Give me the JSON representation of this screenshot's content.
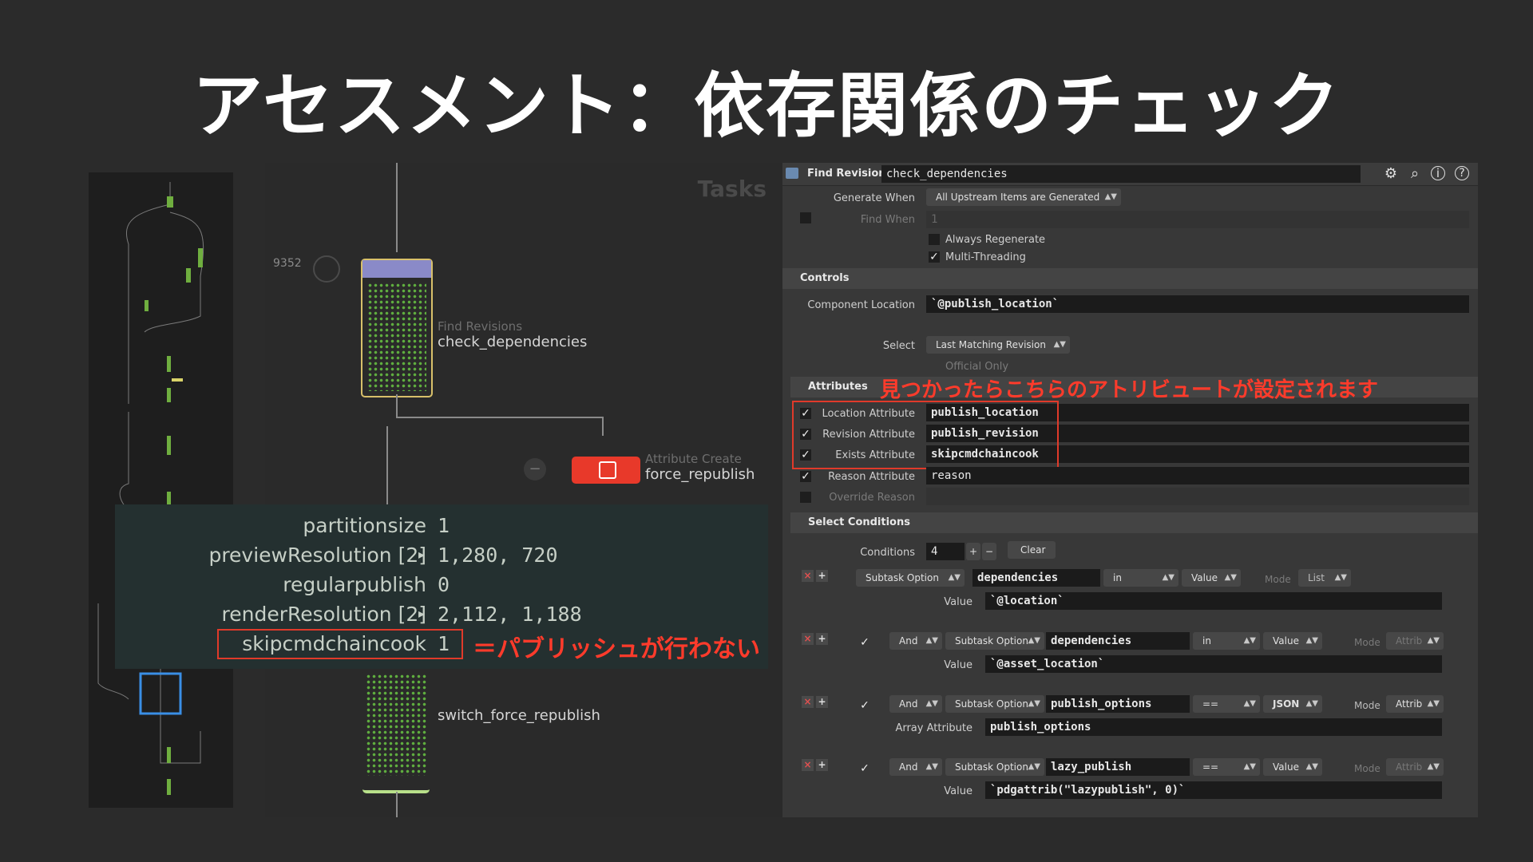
{
  "slide_title": "アセスメント：依存関係のチェック",
  "minimap": {},
  "network": {
    "tasks_label": "Tasks",
    "node_count": "9352",
    "find_node": {
      "type": "Find Revisions",
      "name": "check_dependencies"
    },
    "attr_node": {
      "type": "Attribute Create",
      "name": "force_republish"
    },
    "switch_node": {
      "name": "switch_force_republish"
    }
  },
  "overlay": {
    "rows": [
      {
        "key": "partitionsize",
        "value": "1",
        "arrow": ""
      },
      {
        "key": "previewResolution [2]",
        "value": "1,280,  720",
        "arrow": "▸"
      },
      {
        "key": "regularpublish",
        "value": "0",
        "arrow": ""
      },
      {
        "key": "renderResolution [2]",
        "value": "2,112,  1,188",
        "arrow": "▸"
      },
      {
        "key": "skipcmdchaincook",
        "value": "1",
        "arrow": ""
      }
    ],
    "note": "＝パブリッシュが行わない"
  },
  "panel": {
    "header_type": "Find Revisions",
    "header_name": "check_dependencies",
    "generate_when_label": "Generate When",
    "generate_when_value": "All Upstream Items are Generated",
    "find_when_label": "Find When",
    "find_when_value": "1",
    "always_regenerate": "Always Regenerate",
    "multi_threading": "Multi-Threading",
    "controls": "Controls",
    "component_location_label": "Component Location",
    "component_location_value": "`@publish_location`",
    "select_label": "Select",
    "select_value": "Last Matching Revision",
    "official_only": "Official Only",
    "attributes": "Attributes",
    "attributes_note": "見つかったらこちらのアトリビュートが設定されます",
    "attr_rows": [
      {
        "label": "Location Attribute",
        "value": "publish_location",
        "checked": true,
        "bold": true
      },
      {
        "label": "Revision Attribute",
        "value": "publish_revision",
        "checked": true,
        "bold": true
      },
      {
        "label": "Exists Attribute",
        "value": "skipcmdchaincook",
        "checked": true,
        "bold": true
      },
      {
        "label": "Reason Attribute",
        "value": "reason",
        "checked": true,
        "bold": false
      }
    ],
    "override_reason": "Override Reason",
    "select_conditions": "Select Conditions",
    "conditions_label": "Conditions",
    "conditions_value": "4",
    "plus": "+",
    "minus": "−",
    "clear": "Clear",
    "mode": "Mode",
    "conditions": [
      {
        "join": "",
        "source": "Subtask Option",
        "name": "dependencies",
        "op": "in",
        "kind": "Value",
        "modeval": "List",
        "sub_label": "Value",
        "sub_value": "`@location`"
      },
      {
        "join": "And",
        "source": "Subtask Option",
        "name": "dependencies",
        "op": "in",
        "kind": "Value",
        "modeval": "Attrib",
        "sub_label": "Value",
        "sub_value": "`@asset_location`"
      },
      {
        "join": "And",
        "source": "Subtask Option",
        "name": "publish_options",
        "op": "==",
        "kind": "JSON",
        "modeval": "Attrib",
        "sub_label": "Array Attribute",
        "sub_value": "publish_options"
      },
      {
        "join": "And",
        "source": "Subtask Option",
        "name": "lazy_publish",
        "op": "==",
        "kind": "Value",
        "modeval": "Attrib",
        "sub_label": "Value",
        "sub_value": "`pdgattrib(\"lazypublish\", 0)`"
      }
    ]
  },
  "colors": {
    "accent_red": "#ff3b2b",
    "node_green": "#5fae3f",
    "node_yellow": "#d8c06a"
  }
}
